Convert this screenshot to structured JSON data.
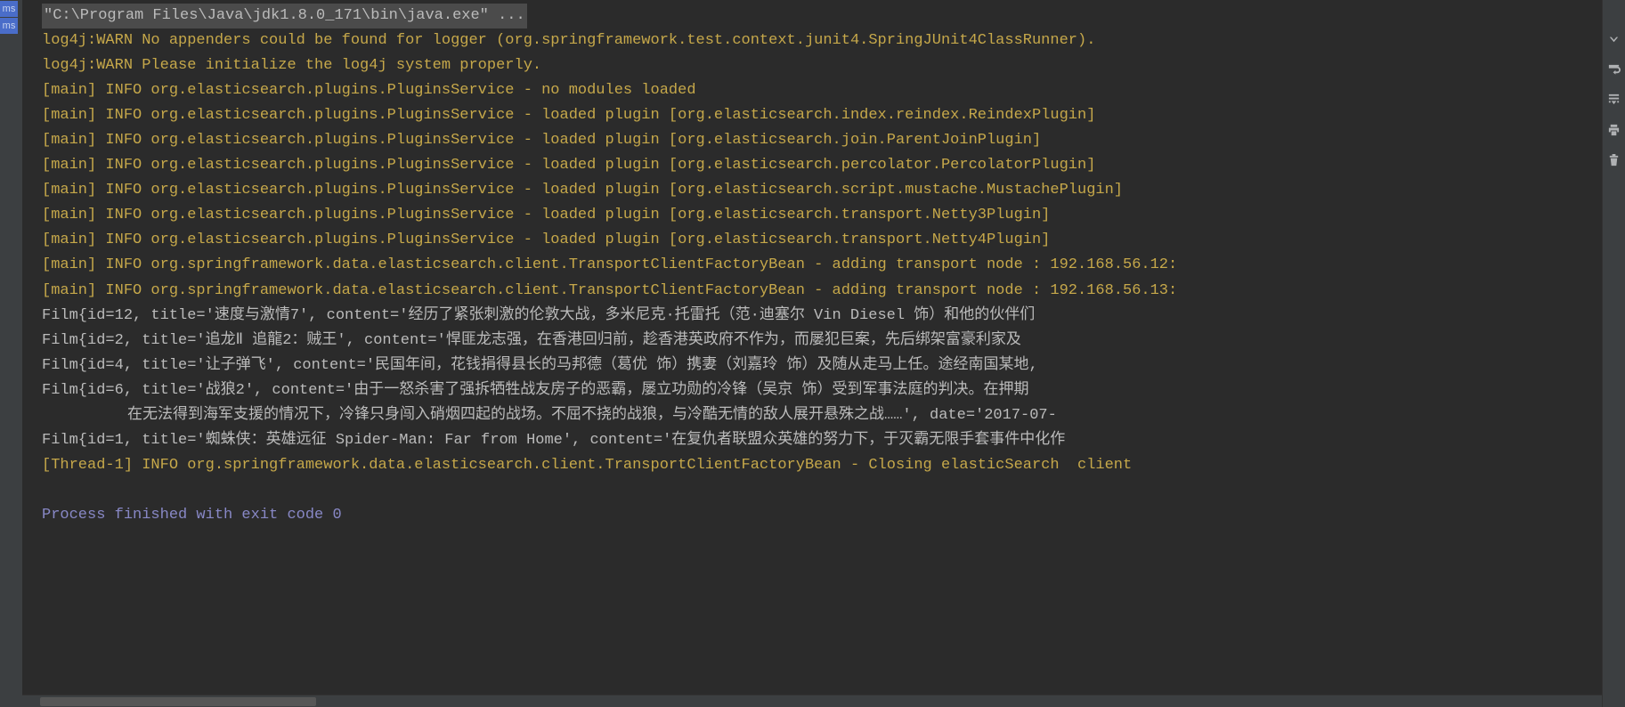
{
  "gutter": {
    "badge1": "ms",
    "badge2": "ms"
  },
  "console": {
    "cmd": "\"C:\\Program Files\\Java\\jdk1.8.0_171\\bin\\java.exe\" ...",
    "lines": [
      {
        "style": "yellow",
        "text": "log4j:WARN No appenders could be found for logger (org.springframework.test.context.junit4.SpringJUnit4ClassRunner)."
      },
      {
        "style": "yellow",
        "text": "log4j:WARN Please initialize the log4j system properly."
      },
      {
        "style": "yellow",
        "text": "[main] INFO org.elasticsearch.plugins.PluginsService - no modules loaded"
      },
      {
        "style": "yellow",
        "text": "[main] INFO org.elasticsearch.plugins.PluginsService - loaded plugin [org.elasticsearch.index.reindex.ReindexPlugin]"
      },
      {
        "style": "yellow",
        "text": "[main] INFO org.elasticsearch.plugins.PluginsService - loaded plugin [org.elasticsearch.join.ParentJoinPlugin]"
      },
      {
        "style": "yellow",
        "text": "[main] INFO org.elasticsearch.plugins.PluginsService - loaded plugin [org.elasticsearch.percolator.PercolatorPlugin]"
      },
      {
        "style": "yellow",
        "text": "[main] INFO org.elasticsearch.plugins.PluginsService - loaded plugin [org.elasticsearch.script.mustache.MustachePlugin]"
      },
      {
        "style": "yellow",
        "text": "[main] INFO org.elasticsearch.plugins.PluginsService - loaded plugin [org.elasticsearch.transport.Netty3Plugin]"
      },
      {
        "style": "yellow",
        "text": "[main] INFO org.elasticsearch.plugins.PluginsService - loaded plugin [org.elasticsearch.transport.Netty4Plugin]"
      },
      {
        "style": "yellow",
        "text": "[main] INFO org.springframework.data.elasticsearch.client.TransportClientFactoryBean - adding transport node : 192.168.56.12:"
      },
      {
        "style": "yellow",
        "text": "[main] INFO org.springframework.data.elasticsearch.client.TransportClientFactoryBean - adding transport node : 192.168.56.13:"
      },
      {
        "style": "gray",
        "text": "Film{id=12, title='速度与激情7', content='经历了紧张刺激的伦敦大战，多米尼克·托雷托（范·迪塞尔 Vin Diesel 饰）和他的伙伴们"
      },
      {
        "style": "gray",
        "text": "Film{id=2, title='追龙Ⅱ 追龍2：贼王', content='悍匪龙志强，在香港回归前，趁香港英政府不作为，而屡犯巨案，先后绑架富豪利家及"
      },
      {
        "style": "gray",
        "text": "Film{id=4, title='让子弹飞', content='民国年间，花钱捐得县长的马邦德（葛优 饰）携妻（刘嘉玲 饰）及随从走马上任。途经南国某地,"
      },
      {
        "style": "gray",
        "text": "Film{id=6, title='战狼2', content='由于一怒杀害了强拆牺牲战友房子的恶霸，屡立功勋的冷锋（吴京 饰）受到军事法庭的判决。在押期"
      },
      {
        "style": "gray",
        "indent": true,
        "text": "在无法得到海军支援的情况下，冷锋只身闯入硝烟四起的战场。不屈不挠的战狼，与冷酷无情的敌人展开悬殊之战……', date='2017-07-"
      },
      {
        "style": "gray",
        "text": "Film{id=1, title='蜘蛛侠：英雄远征 Spider-Man: Far from Home', content='在复仇者联盟众英雄的努力下，于灭霸无限手套事件中化作"
      },
      {
        "style": "yellow",
        "text": "[Thread-1] INFO org.springframework.data.elasticsearch.client.TransportClientFactoryBean - Closing elasticSearch  client"
      }
    ],
    "exit_msg": "Process finished with exit code 0"
  }
}
